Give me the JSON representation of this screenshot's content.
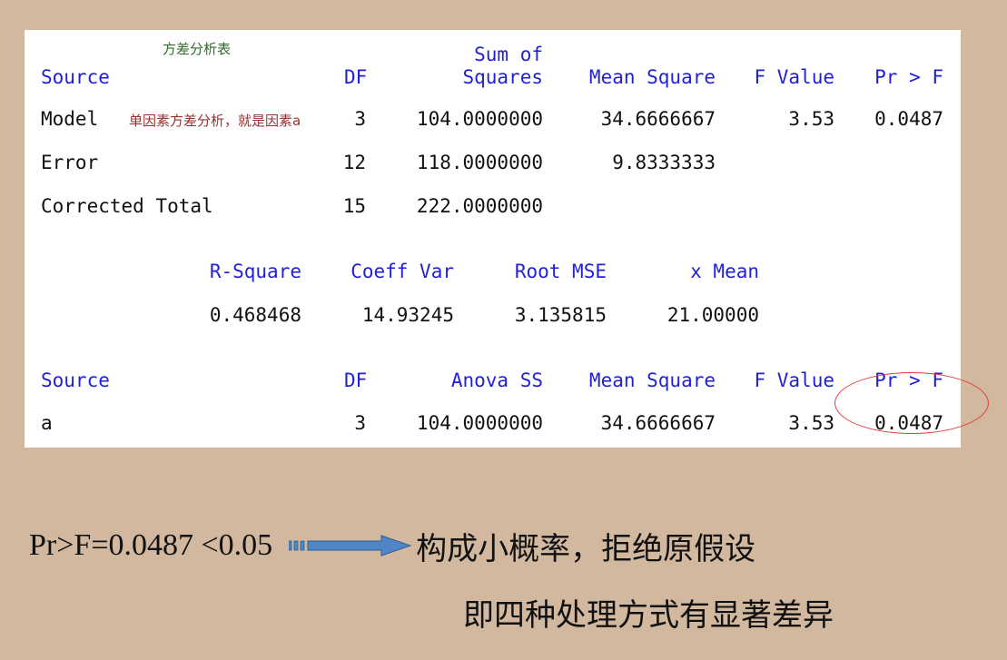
{
  "anova": {
    "title_note": "方差分析表",
    "headers": {
      "source": "Source",
      "df": "DF",
      "ss_line1": "Sum of",
      "ss_line2": "Squares",
      "ms": "Mean Square",
      "f": "F Value",
      "p": "Pr > F"
    },
    "model_note": "单因素方差分析，就是因素a",
    "rows": [
      {
        "source": "Model",
        "df": "3",
        "ss": "104.0000000",
        "ms": "34.6666667",
        "f": "3.53",
        "p": "0.0487"
      },
      {
        "source": "Error",
        "df": "12",
        "ss": "118.0000000",
        "ms": "9.8333333",
        "f": "",
        "p": ""
      },
      {
        "source": "Corrected Total",
        "df": "15",
        "ss": "222.0000000",
        "ms": "",
        "f": "",
        "p": ""
      }
    ]
  },
  "fit": {
    "headers": {
      "rsq": "R-Square",
      "cv": "Coeff Var",
      "rmse": "Root MSE",
      "mean": "x Mean"
    },
    "values": {
      "rsq": "0.468468",
      "cv": "14.93245",
      "rmse": "3.135815",
      "mean": "21.00000"
    }
  },
  "type_ss": {
    "headers": {
      "source": "Source",
      "df": "DF",
      "ss": "Anova SS",
      "ms": "Mean Square",
      "f": "F Value",
      "p": "Pr > F"
    },
    "row": {
      "source": "a",
      "df": "3",
      "ss": "104.0000000",
      "ms": "34.6666667",
      "f": "3.53",
      "p": "0.0487"
    }
  },
  "conclusion": {
    "formula": "Pr>F=0.0487  <0.05",
    "line1": "构成小概率，拒绝原假设",
    "line2": "即四种处理方式有显著差异"
  },
  "colors": {
    "background": "#d2b89e",
    "header_blue": "#1f1fdc",
    "circle_red": "#e53a3a",
    "arrow_blue": "#4f86c6"
  }
}
